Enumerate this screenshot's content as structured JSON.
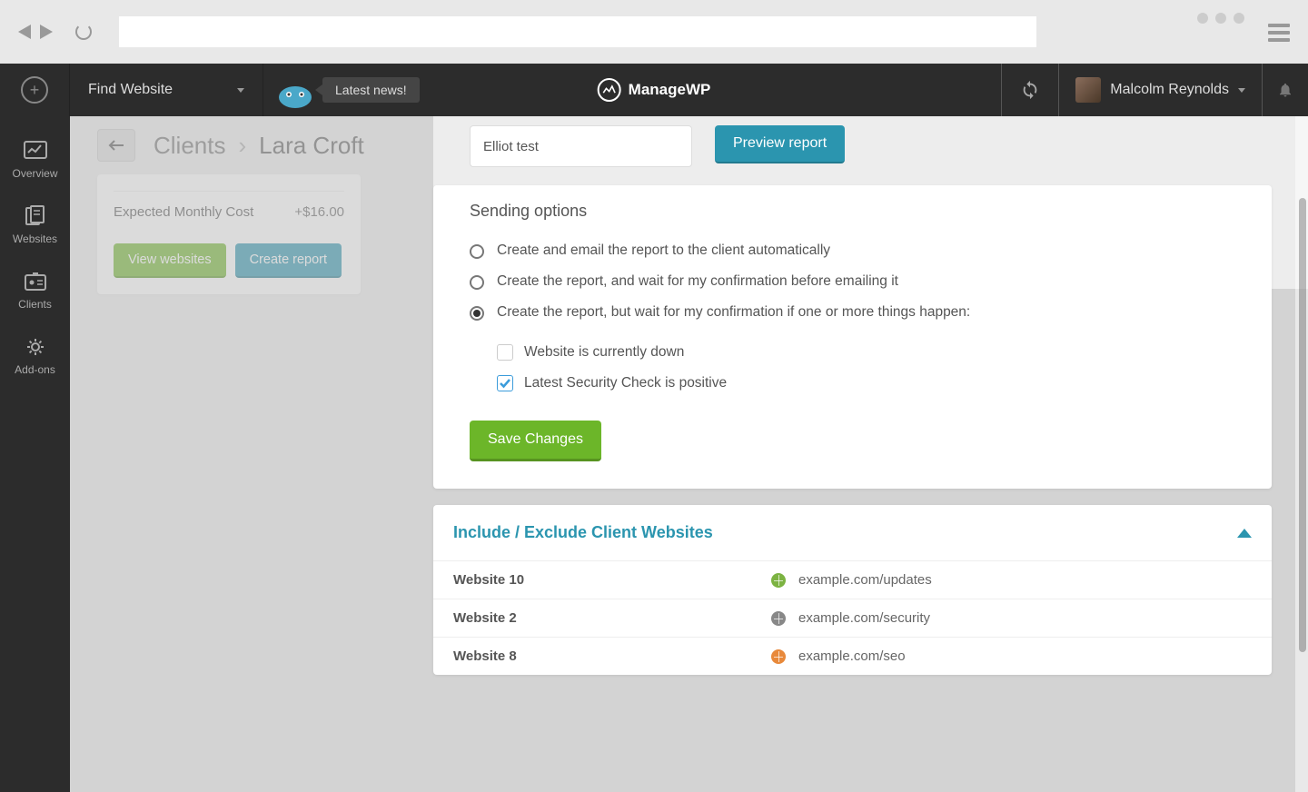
{
  "brand": "ManageWP",
  "header": {
    "find_website": "Find Website",
    "latest_news": "Latest news!",
    "user_name": "Malcolm Reynolds"
  },
  "sidebar": {
    "overview": "Overview",
    "websites": "Websites",
    "clients": "Clients",
    "addons": "Add-ons"
  },
  "breadcrumb": {
    "parent": "Clients",
    "current": "Lara Croft"
  },
  "cost_card": {
    "label": "Expected Monthly Cost",
    "value": "+$16.00",
    "view_websites": "View websites",
    "create_report": "Create report"
  },
  "report": {
    "name_value": "Elliot test",
    "preview": "Preview report",
    "sending_title": "Sending options",
    "opt_auto": "Create and email the report to the client automatically",
    "opt_confirm": "Create the report, and wait for my confirmation before emailing it",
    "opt_conditional": "Create the report, but wait for my confirmation if one or more things happen:",
    "check_down": "Website is currently down",
    "check_security": "Latest Security Check is positive",
    "save": "Save Changes"
  },
  "include_panel": {
    "title": "Include / Exclude Client Websites",
    "rows": [
      {
        "name": "Website 10",
        "url": "example.com/updates",
        "status": "green"
      },
      {
        "name": "Website 2",
        "url": "example.com/security",
        "status": "grey"
      },
      {
        "name": "Website 8",
        "url": "example.com/seo",
        "status": "orange"
      }
    ]
  }
}
